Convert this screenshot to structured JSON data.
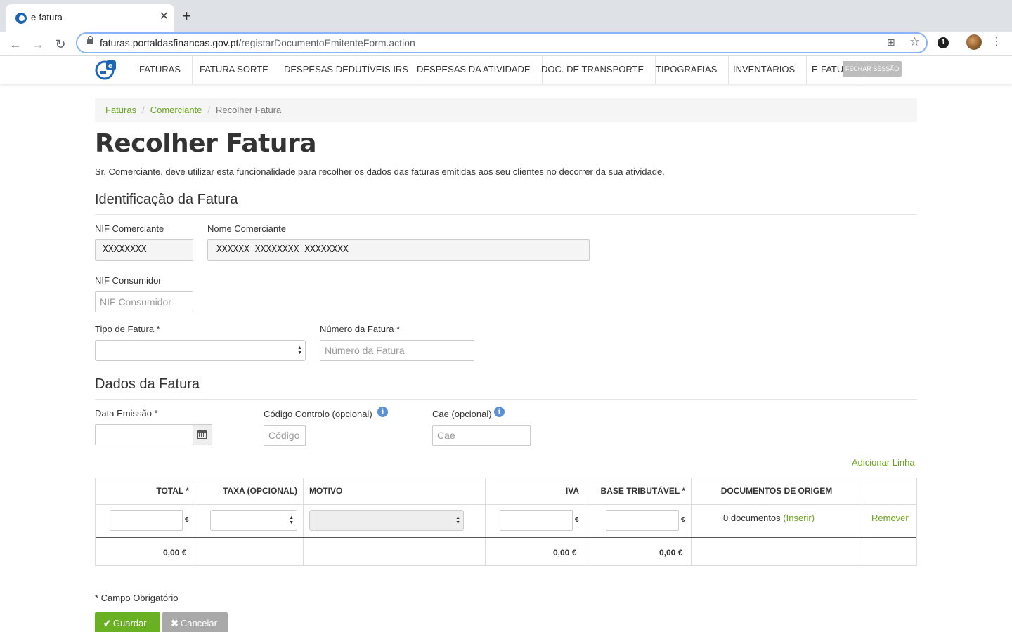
{
  "browser": {
    "tab_title": "e-fatura",
    "tab_close": "✕",
    "new_tab": "+",
    "url_host": "faturas.portaldasfinancas.gov.pt",
    "url_path": "/registarDocumentoEmitenteForm.action",
    "back": "←",
    "forward": "→",
    "reload": "↻",
    "translate_icon": "⊞",
    "star_icon": "☆",
    "extension_badge": "1",
    "menu": "⋮"
  },
  "nav": {
    "items": [
      "FATURAS",
      "FATURA SORTE",
      "DESPESAS DEDUTÍVEIS IRS",
      "DESPESAS DA ATIVIDADE",
      "DOC. DE TRANSPORTE",
      "TIPOGRAFIAS",
      "INVENTÁRIOS",
      "E-FATUI"
    ],
    "logout": "FECHAR SESSÃO"
  },
  "breadcrumb": {
    "items": [
      "Faturas",
      "Comerciante"
    ],
    "separator": "/",
    "current": "Recolher Fatura"
  },
  "page": {
    "title": "Recolher Fatura",
    "intro": "Sr. Comerciante, deve utilizar esta funcionalidade para recolher os dados das faturas emitidas aos seu clientes no decorrer da sua atividade."
  },
  "identificacao": {
    "title": "Identificação da Fatura",
    "nif_comerciante_label": "NIF Comerciante",
    "nif_comerciante_value": "XXXXXXXX",
    "nome_comerciante_label": "Nome Comerciante",
    "nome_comerciante_value": "XXXXXX XXXXXXXX XXXXXXXX",
    "nif_consumidor_label": "NIF Consumidor",
    "nif_consumidor_placeholder": "NIF Consumidor",
    "tipo_fatura_label": "Tipo de Fatura *",
    "numero_fatura_label": "Número da Fatura *",
    "numero_fatura_placeholder": "Número da Fatura"
  },
  "dados": {
    "title": "Dados da Fatura",
    "data_emissao_label": "Data Emissão *",
    "codigo_label": "Código Controlo (opcional)",
    "codigo_placeholder": "Código",
    "cae_label": "Cae (opcional)",
    "cae_placeholder": "Cae",
    "info_icon": "i",
    "add_line": "Adicionar Linha"
  },
  "table": {
    "headers": [
      "TOTAL *",
      "TAXA (OPCIONAL)",
      "MOTIVO",
      "IVA",
      "BASE TRIBUTÁVEL *",
      "DOCUMENTOS DE ORIGEM"
    ],
    "euro": "€",
    "docs_count": "0 documentos",
    "docs_insert": "(Inserir)",
    "remove": "Remover",
    "totals": {
      "total": "0,00 €",
      "iva": "0,00 €",
      "base": "0,00 €"
    }
  },
  "footer": {
    "required_note": "* Campo Obrigatório",
    "save": "Guardar",
    "cancel": "Cancelar",
    "save_icon": "✔",
    "cancel_icon": "✖"
  },
  "colors": {
    "accent": "#6aa41c",
    "save_button": "#6ab023",
    "cancel_button": "#a9a9a9",
    "info_icon": "#5b8fd6"
  }
}
